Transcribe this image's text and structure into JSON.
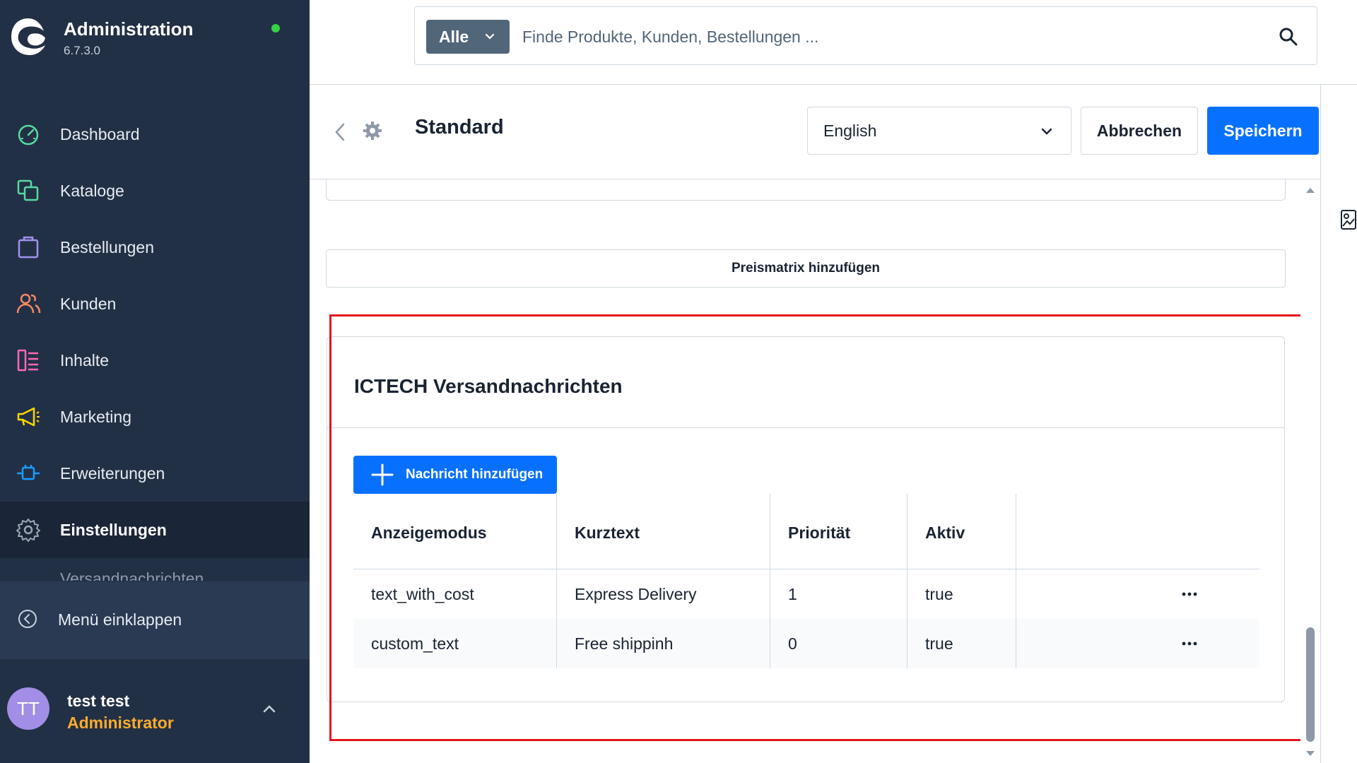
{
  "sidebar": {
    "title": "Administration",
    "version": "6.7.3.0",
    "items": [
      {
        "label": "Dashboard",
        "icon": "dashboard-icon",
        "color": "#57d9a3"
      },
      {
        "label": "Kataloge",
        "icon": "catalog-icon",
        "color": "#57d9a3"
      },
      {
        "label": "Bestellungen",
        "icon": "orders-icon",
        "color": "#a092f0"
      },
      {
        "label": "Kunden",
        "icon": "customers-icon",
        "color": "#f88962"
      },
      {
        "label": "Inhalte",
        "icon": "content-icon",
        "color": "#ff68b4"
      },
      {
        "label": "Marketing",
        "icon": "marketing-icon",
        "color": "#ffd700"
      },
      {
        "label": "Erweiterungen",
        "icon": "extensions-icon",
        "color": "#189eff"
      },
      {
        "label": "Einstellungen",
        "icon": "settings-icon",
        "color": "#9aa8b5"
      }
    ],
    "sub_item": "Versandnachrichten",
    "collapse_label": "Menü einklappen",
    "user": {
      "initials": "TT",
      "name": "test test",
      "role": "Administrator"
    }
  },
  "search": {
    "type_label": "Alle",
    "placeholder": "Finde Produkte, Kunden, Bestellungen ..."
  },
  "header": {
    "title": "Standard",
    "language": "English",
    "cancel_label": "Abbrechen",
    "save_label": "Speichern"
  },
  "content": {
    "matrix_label": "Preismatrix hinzufügen",
    "card": {
      "title": "ICTECH Versandnachrichten",
      "add_label": "Nachricht hinzufügen",
      "columns": [
        "Anzeigemodus",
        "Kurztext",
        "Priorität",
        "Aktiv"
      ],
      "rows": [
        {
          "mode": "text_with_cost",
          "text": "Express Delivery",
          "priority": "1",
          "active": "true"
        },
        {
          "mode": "custom_text",
          "text": "Free shippinh",
          "priority": "0",
          "active": "true"
        }
      ]
    }
  },
  "colors": {
    "sidebar_bg": "#223045",
    "primary": "#0870ff",
    "highlight": "#e3141e",
    "status_online": "#37d046",
    "role": "#ffab2e"
  }
}
